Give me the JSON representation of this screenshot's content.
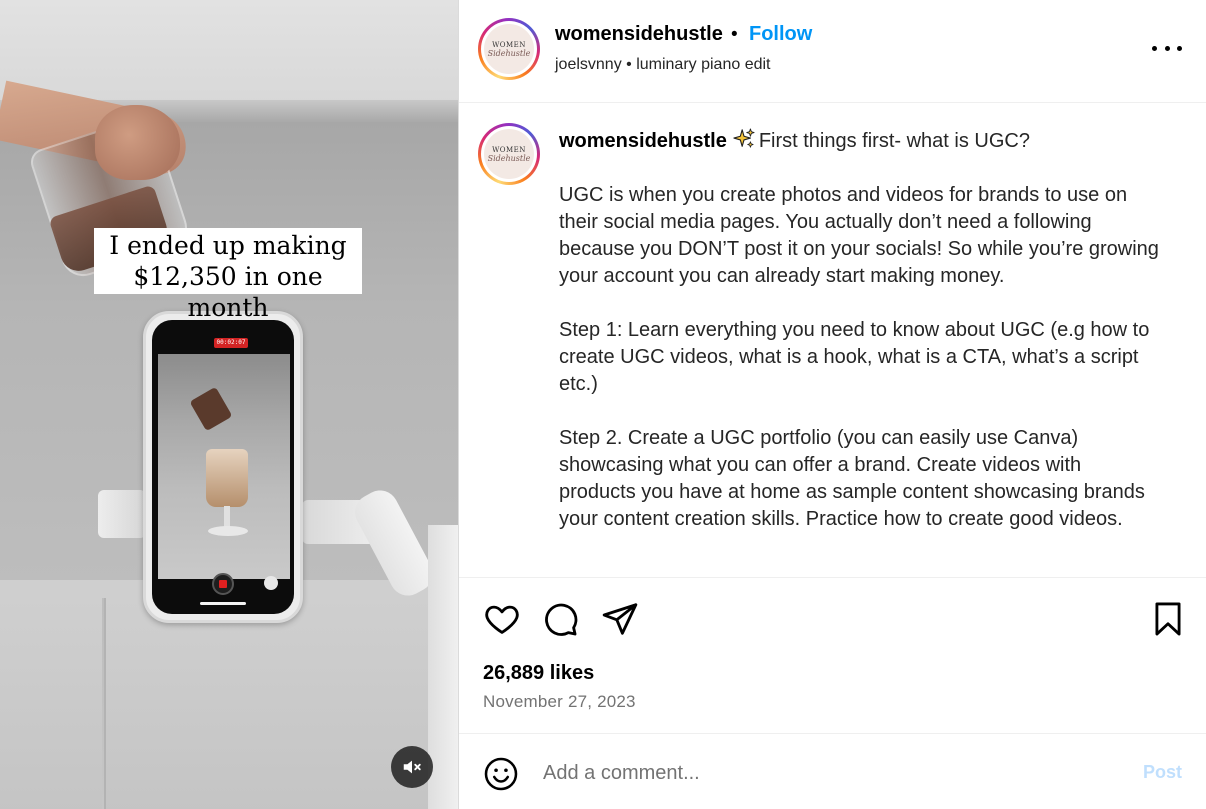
{
  "media": {
    "overlay_lines": [
      "I ended up making",
      "$12,350 in one month"
    ],
    "rec_timer": "00:02:07",
    "mute_icon": "speaker-muted-icon"
  },
  "avatar": {
    "top_text": "WOMEN",
    "script_text": "Sidehustle"
  },
  "header": {
    "username": "womensidehustle",
    "separator": "•",
    "follow_label": "Follow",
    "audio_info": "joelsvnny • luminary piano edit",
    "more_icon": "more-options-icon"
  },
  "caption": {
    "username": "womensidehustle",
    "emoji": "sparkles-icon",
    "first_line": "First things first- what is UGC?",
    "paragraphs": [
      "UGC is when you create photos and videos for brands to use on their social media pages. You actually don’t need a following because you DON’T post it on your socials! So while you’re growing your account you can already start making money.",
      "Step 1: Learn everything you need to know about UGC (e.g how to create UGC videos, what is a hook, what is a CTA, what’s a script etc.)",
      "Step 2. Create a UGC portfolio (you can easily use Canva) showcasing what you can offer a brand. Create videos with products you have at home as sample content showcasing brands your content creation skills. Practice how to create good videos."
    ]
  },
  "actions": {
    "icons": [
      "heart-icon",
      "comment-icon",
      "share-icon",
      "bookmark-icon"
    ],
    "likes": "26,889 likes",
    "date": "November 27, 2023"
  },
  "comment": {
    "placeholder": "Add a comment...",
    "post_label": "Post",
    "emoji_icon": "emoji-icon"
  },
  "colors": {
    "accent": "#0095f6",
    "post_disabled": "#c0dffd",
    "muted_text": "#737373"
  }
}
